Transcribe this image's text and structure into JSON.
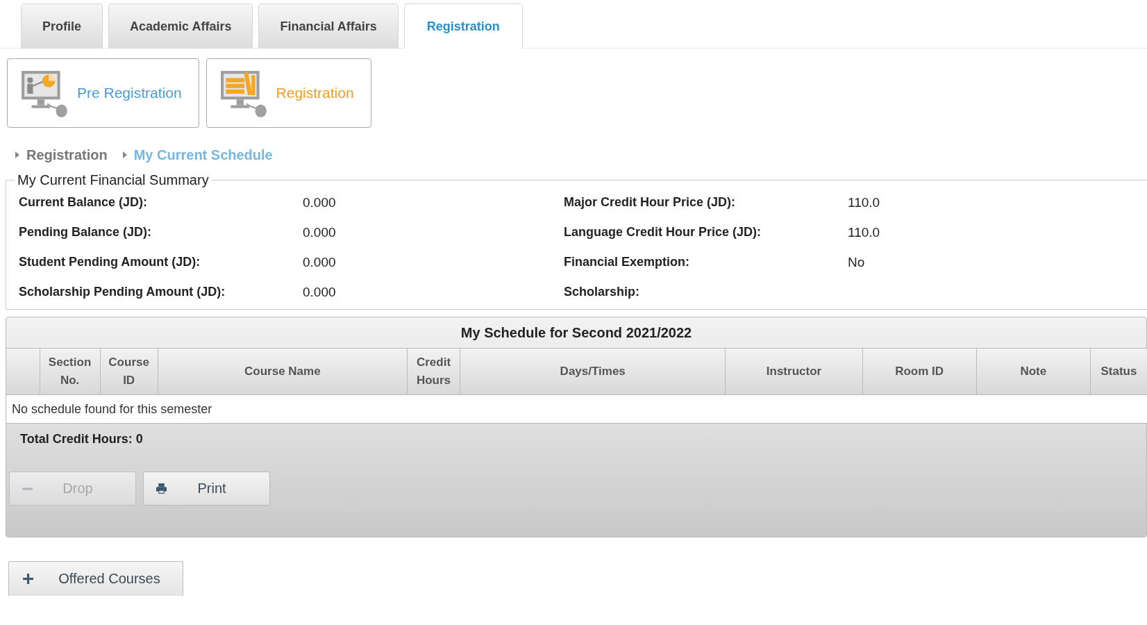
{
  "tabs": [
    {
      "label": "Profile",
      "selected": false
    },
    {
      "label": "Academic Affairs",
      "selected": false
    },
    {
      "label": "Financial Affairs",
      "selected": false
    },
    {
      "label": "Registration",
      "selected": true
    }
  ],
  "sections": [
    {
      "label": "Pre Registration",
      "kind": "presentation",
      "selected": false
    },
    {
      "label": "Registration",
      "kind": "books",
      "selected": true
    }
  ],
  "breadcrumb": [
    {
      "label": "Registration",
      "current": false
    },
    {
      "label": "My Current Schedule",
      "current": true
    }
  ],
  "financial_summary": {
    "title": "My Current Financial Summary",
    "left": [
      {
        "label": "Current Balance (JD):",
        "value": "0.000"
      },
      {
        "label": "Pending Balance (JD):",
        "value": "0.000"
      },
      {
        "label": "Student Pending Amount (JD):",
        "value": "0.000"
      },
      {
        "label": "Scholarship Pending Amount (JD):",
        "value": "0.000"
      }
    ],
    "right": [
      {
        "label": "Major Credit Hour Price (JD):",
        "value": "110.0"
      },
      {
        "label": "Language Credit Hour Price (JD):",
        "value": "110.0"
      },
      {
        "label": "Financial Exemption:",
        "value": "No"
      },
      {
        "label": "Scholarship:"
      }
    ]
  },
  "schedule": {
    "title": "My Schedule for Second 2021/2022",
    "columns": [
      "",
      "Section No.",
      "Course ID",
      "Course Name",
      "Credit Hours",
      "Days/Times",
      "Instructor",
      "Room ID",
      "Note",
      "Status"
    ],
    "empty_message": "No schedule found for this semester",
    "total": "Total Credit Hours: 0",
    "buttons": [
      {
        "label": "Drop",
        "kind": "minus",
        "disabled": true
      },
      {
        "label": "Print",
        "kind": "print",
        "disabled": false
      }
    ]
  },
  "offered_courses": {
    "label": "Offered Courses",
    "expanded": false
  }
}
